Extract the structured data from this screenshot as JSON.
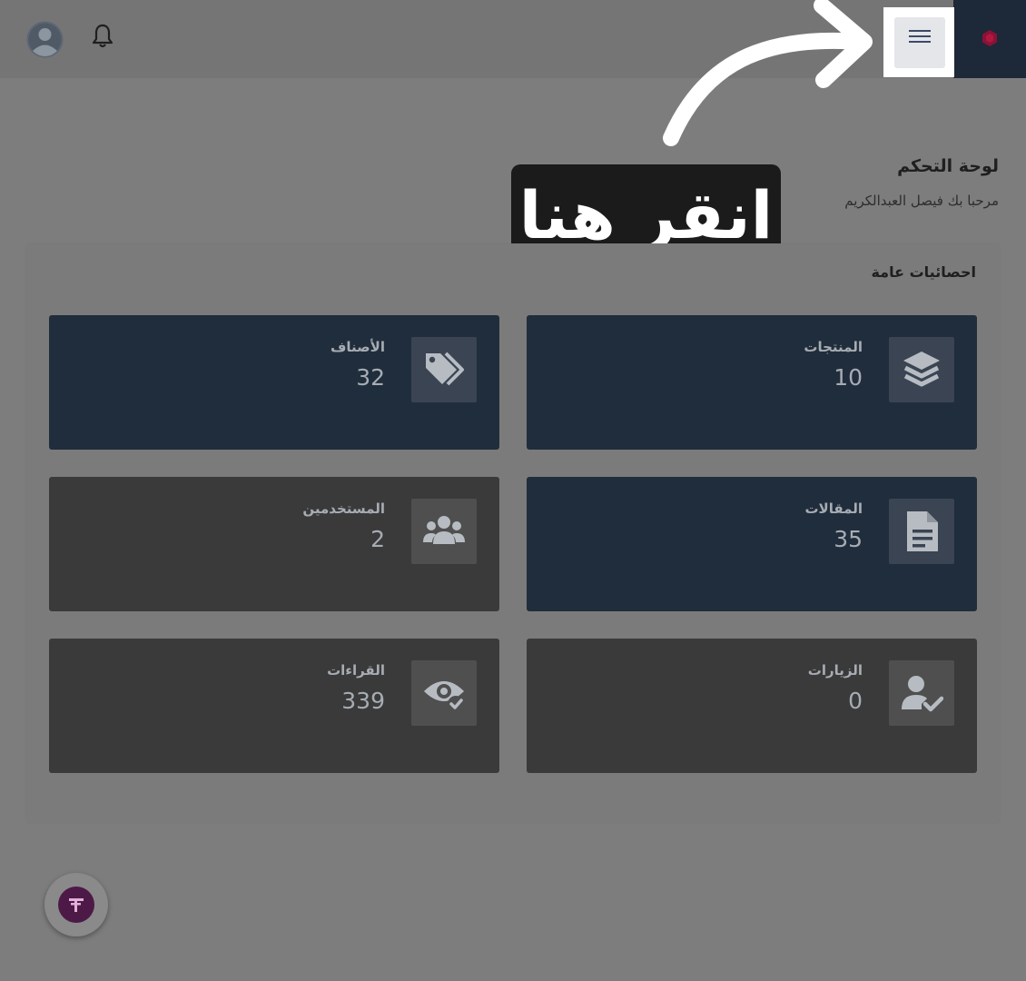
{
  "header": {
    "menu_icon": "hamburger-menu-icon",
    "notification_icon": "bell-icon",
    "avatar_icon": "user-avatar-icon",
    "brand_color": "#1d2838"
  },
  "callout": {
    "text": "انقر هنا"
  },
  "page": {
    "title": "لوحة التحكم",
    "subtitle": "مرحبا بك فيصل العبدالكريم"
  },
  "stats": {
    "title": "احصائيات عامة",
    "cards": [
      {
        "label": "المنتجات",
        "value": "10",
        "icon": "layers-icon",
        "color": "#202d3c"
      },
      {
        "label": "الأصناف",
        "value": "32",
        "icon": "tags-icon",
        "color": "#202d3c"
      },
      {
        "label": "المقالات",
        "value": "35",
        "icon": "document-icon",
        "color": "#202d3c"
      },
      {
        "label": "المستخدمين",
        "value": "2",
        "icon": "users-icon",
        "color": "#3a3a3a"
      },
      {
        "label": "الزيارات",
        "value": "0",
        "icon": "user-check-icon",
        "color": "#3a3a3a"
      },
      {
        "label": "القراءات",
        "value": "339",
        "icon": "eye-check-icon",
        "color": "#3a3a3a"
      }
    ]
  },
  "fab": {
    "icon": "app-logo-icon",
    "color": "#4d1a48"
  }
}
